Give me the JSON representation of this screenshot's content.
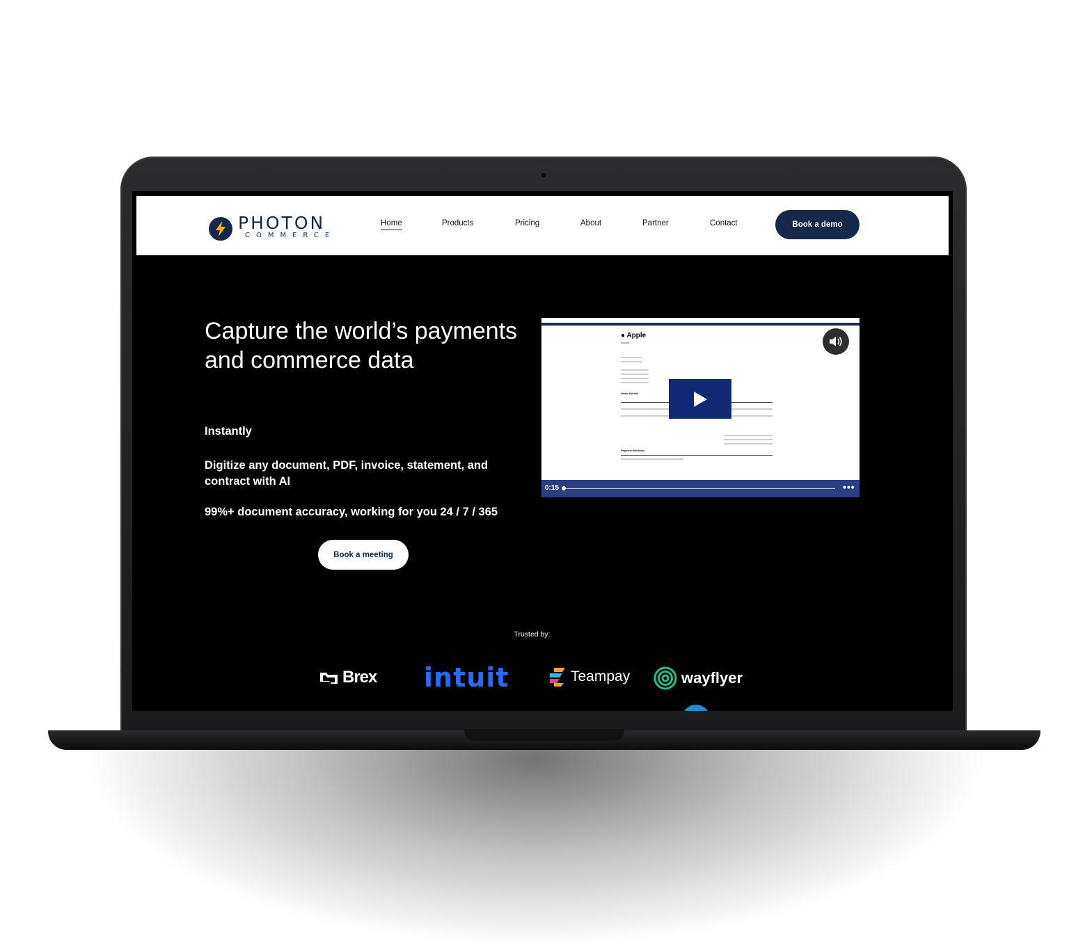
{
  "site": {
    "logo": {
      "word": "PHOTON",
      "sub": "COMMERCE"
    },
    "nav": [
      {
        "label": "Home",
        "active": true
      },
      {
        "label": "Products"
      },
      {
        "label": "Pricing"
      },
      {
        "label": "About"
      },
      {
        "label": "Partner"
      },
      {
        "label": "Contact"
      }
    ],
    "cta": "Book a demo"
  },
  "hero": {
    "title": "Capture the world’s payments and commerce data",
    "instantly": "Instantly",
    "description": "Digitize any document, PDF, invoice, statement, and contract with AI",
    "accuracy": "99%+ document accuracy, working for you 24 / 7 / 365",
    "button": "Book a meeting"
  },
  "video": {
    "doc_brand": "Apple",
    "doc_subtitle": "Invoice",
    "doc_order_details": "Order Details",
    "doc_payment": "Payment Methods",
    "time": "0:15",
    "more": "•••",
    "icons": {
      "play": "play-icon",
      "volume": "volume-icon",
      "more": "more-icon"
    }
  },
  "trusted": {
    "label": "Trusted by:",
    "brands": [
      {
        "name": "Brex"
      },
      {
        "name": "intuit"
      },
      {
        "name": "Teampay"
      },
      {
        "name": "wayflyer"
      }
    ]
  },
  "colors": {
    "brand_navy": "#14284b",
    "intuit_blue": "#236cff",
    "wayflyer_green": "#1fc08a",
    "video_bar": "#193078"
  }
}
